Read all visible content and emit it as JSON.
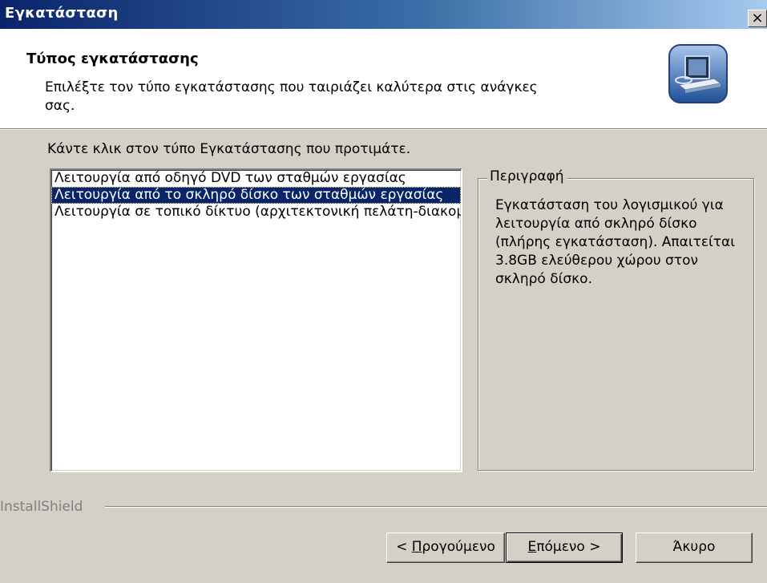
{
  "window": {
    "title": "Εγκατάσταση",
    "close_glyph": "×"
  },
  "header": {
    "title": "Τύπος εγκατάστασης",
    "description": "Επιλέξτε τον τύπο εγκατάστασης που ταιριάζει καλύτερα στις ανάγκες σας.",
    "icon": "setup-computer-icon"
  },
  "instruction": "Κάντε κλικ στον τύπο Εγκατάστασης που προτιμάτε.",
  "setup_types": [
    {
      "label": "Λειτουργία από οδηγό DVD των σταθμών εργασίας",
      "selected": false
    },
    {
      "label": "Λειτουργία από το σκληρό δίσκο των σταθμών εργασίας",
      "selected": true
    },
    {
      "label": "Λειτουργία σε τοπικό δίκτυο (αρχιτεκτονική πελάτη-διακομιστή)",
      "selected": false
    }
  ],
  "description_group": {
    "legend": "Περιγραφή",
    "text": "Εγκατάσταση του λογισμικού για λειτουργία από σκληρό δίσκο (πλήρης εγκατάσταση). Απαιτείται 3.8GB ελεύθερου χώρου στον σκληρό δίσκο."
  },
  "branding": "InstallShield",
  "buttons": {
    "back": {
      "prefix": "< ",
      "mnemonic": "Π",
      "rest": "ρογούμενο"
    },
    "next": {
      "mnemonic": "Ε",
      "rest": "πόμενο >"
    },
    "cancel": "Άκυρο"
  },
  "colors": {
    "title_gradient_start": "#0a246a",
    "title_gradient_end": "#a6caf0",
    "selection": "#0a246a",
    "face": "#d4d0c8"
  }
}
